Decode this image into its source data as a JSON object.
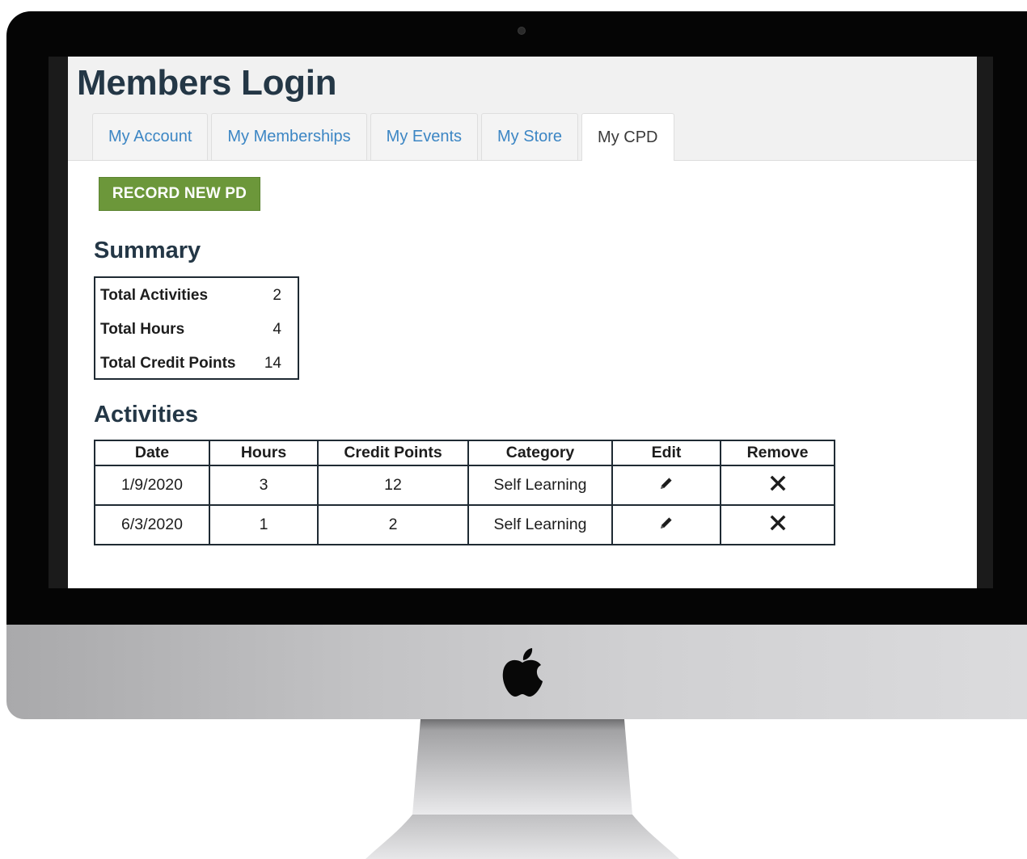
{
  "page": {
    "title": "Members Login"
  },
  "tabs": [
    {
      "label": "My Account",
      "active": false
    },
    {
      "label": "My Memberships",
      "active": false
    },
    {
      "label": "My Events",
      "active": false
    },
    {
      "label": "My Store",
      "active": false
    },
    {
      "label": "My CPD",
      "active": true
    }
  ],
  "actions": {
    "record_label": "RECORD NEW PD"
  },
  "summary": {
    "heading": "Summary",
    "rows": [
      {
        "label": "Total Activities",
        "value": "2"
      },
      {
        "label": "Total Hours",
        "value": "4"
      },
      {
        "label": "Total Credit Points",
        "value": "14"
      }
    ]
  },
  "activities": {
    "heading": "Activities",
    "columns": [
      "Date",
      "Hours",
      "Credit Points",
      "Category",
      "Edit",
      "Remove"
    ],
    "rows": [
      {
        "date": "1/9/2020",
        "hours": "3",
        "credit_points": "12",
        "category": "Self Learning",
        "edit_icon": "pencil-icon",
        "remove_icon": "x-icon"
      },
      {
        "date": "6/3/2020",
        "hours": "1",
        "credit_points": "2",
        "category": "Self Learning",
        "edit_icon": "pencil-icon",
        "remove_icon": "x-icon"
      }
    ]
  },
  "colors": {
    "heading": "#243746",
    "tab_link": "#3c86c4",
    "button_green": "#6c973a",
    "table_border": "#1f2a33"
  }
}
